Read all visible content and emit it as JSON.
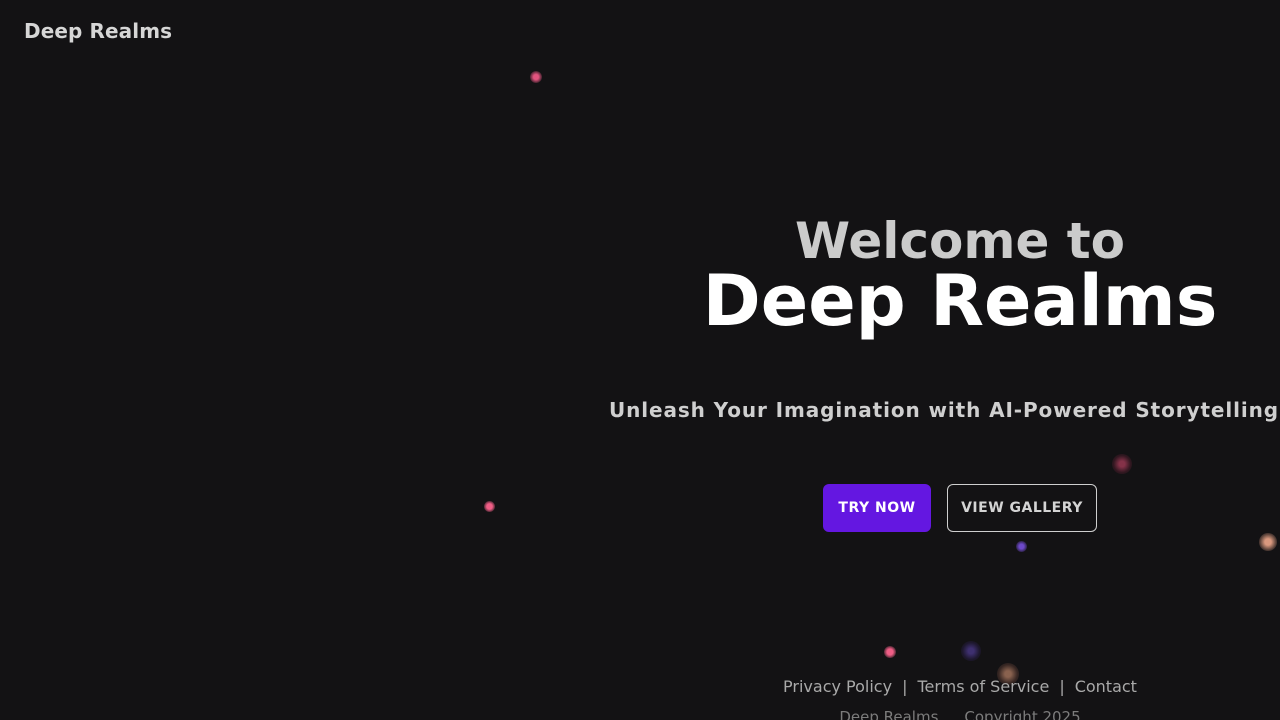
{
  "header": {
    "brand": "Deep Realms"
  },
  "hero": {
    "welcome": "Welcome to",
    "title": "Deep Realms",
    "subtitle": "Unleash Your Imagination with AI-Powered Storytelling"
  },
  "actions": {
    "try_now": "TRY NOW",
    "view_gallery": "VIEW GALLERY"
  },
  "footer": {
    "links": [
      "Privacy Policy",
      "Terms of Service",
      "Contact"
    ],
    "separator": "|",
    "copyright_name": "Deep Realms",
    "copyright_text": "Copyright 2025"
  },
  "colors": {
    "background": "#131214",
    "primary_button": "#6417e1",
    "particle_pink": "#e2547f",
    "particle_purple": "#6d49c9",
    "particle_peach": "#d9987e"
  }
}
